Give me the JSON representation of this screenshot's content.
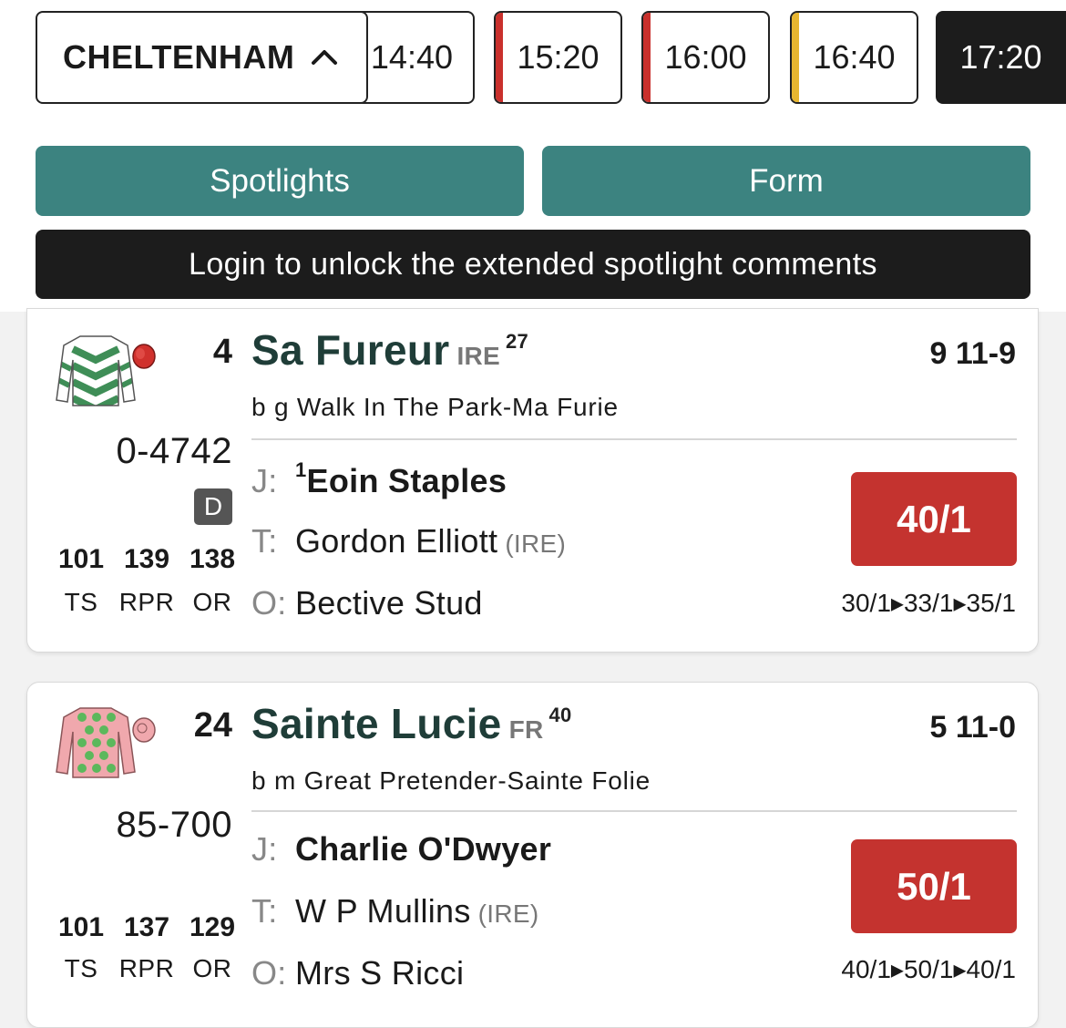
{
  "header": {
    "course": "CHELTENHAM",
    "race_times": [
      {
        "time": "14:40",
        "stripe": "",
        "active": false
      },
      {
        "time": "15:20",
        "stripe": "#c9302c",
        "active": false
      },
      {
        "time": "16:00",
        "stripe": "#c9302c",
        "active": false
      },
      {
        "time": "16:40",
        "stripe": "#e8b630",
        "active": false
      },
      {
        "time": "17:20",
        "stripe": "",
        "active": true
      }
    ],
    "spotlights_label": "Spotlights",
    "form_label": "Form",
    "login_message": "Login to unlock the extended spotlight comments"
  },
  "runners": [
    {
      "number": "4",
      "name": "Sa Fureur",
      "suffix": "IRE",
      "days": "27",
      "age_weight": "9 11-9",
      "breeding": "b g   Walk In The Park-Ma Furie",
      "form": "0-4742",
      "badge": "D",
      "ratings": {
        "ts": "101",
        "rpr": "139",
        "or": "138"
      },
      "rating_labels": {
        "ts": "TS",
        "rpr": "RPR",
        "or": "OR"
      },
      "jockey_prefix": "J:",
      "jockey_claim": "1",
      "jockey": "Eoin Staples",
      "trainer_prefix": "T:",
      "trainer": "Gordon Elliott",
      "trainer_country": "(IRE)",
      "owner_prefix": "O:",
      "owner": "Bective Stud",
      "odds": "40/1",
      "price_history": "30/1▸33/1▸35/1",
      "silk": "green-white-chevrons-icon"
    },
    {
      "number": "24",
      "name": "Sainte Lucie",
      "suffix": "FR",
      "days": "40",
      "age_weight": "5 11-0",
      "breeding": "b m   Great Pretender-Sainte Folie",
      "form": "85-700",
      "badge": "",
      "ratings": {
        "ts": "101",
        "rpr": "137",
        "or": "129"
      },
      "rating_labels": {
        "ts": "TS",
        "rpr": "RPR",
        "or": "OR"
      },
      "jockey_prefix": "J:",
      "jockey_claim": "",
      "jockey": "Charlie O'Dwyer",
      "trainer_prefix": "T:",
      "trainer": "W P Mullins",
      "trainer_country": "(IRE)",
      "owner_prefix": "O:",
      "owner": "Mrs S Ricci",
      "odds": "50/1",
      "price_history": "40/1▸50/1▸40/1",
      "silk": "pink-green-spots-icon"
    }
  ],
  "colors": {
    "teal": "#3c8380",
    "odds_red": "#c4332f",
    "dark": "#1c1c1c"
  }
}
